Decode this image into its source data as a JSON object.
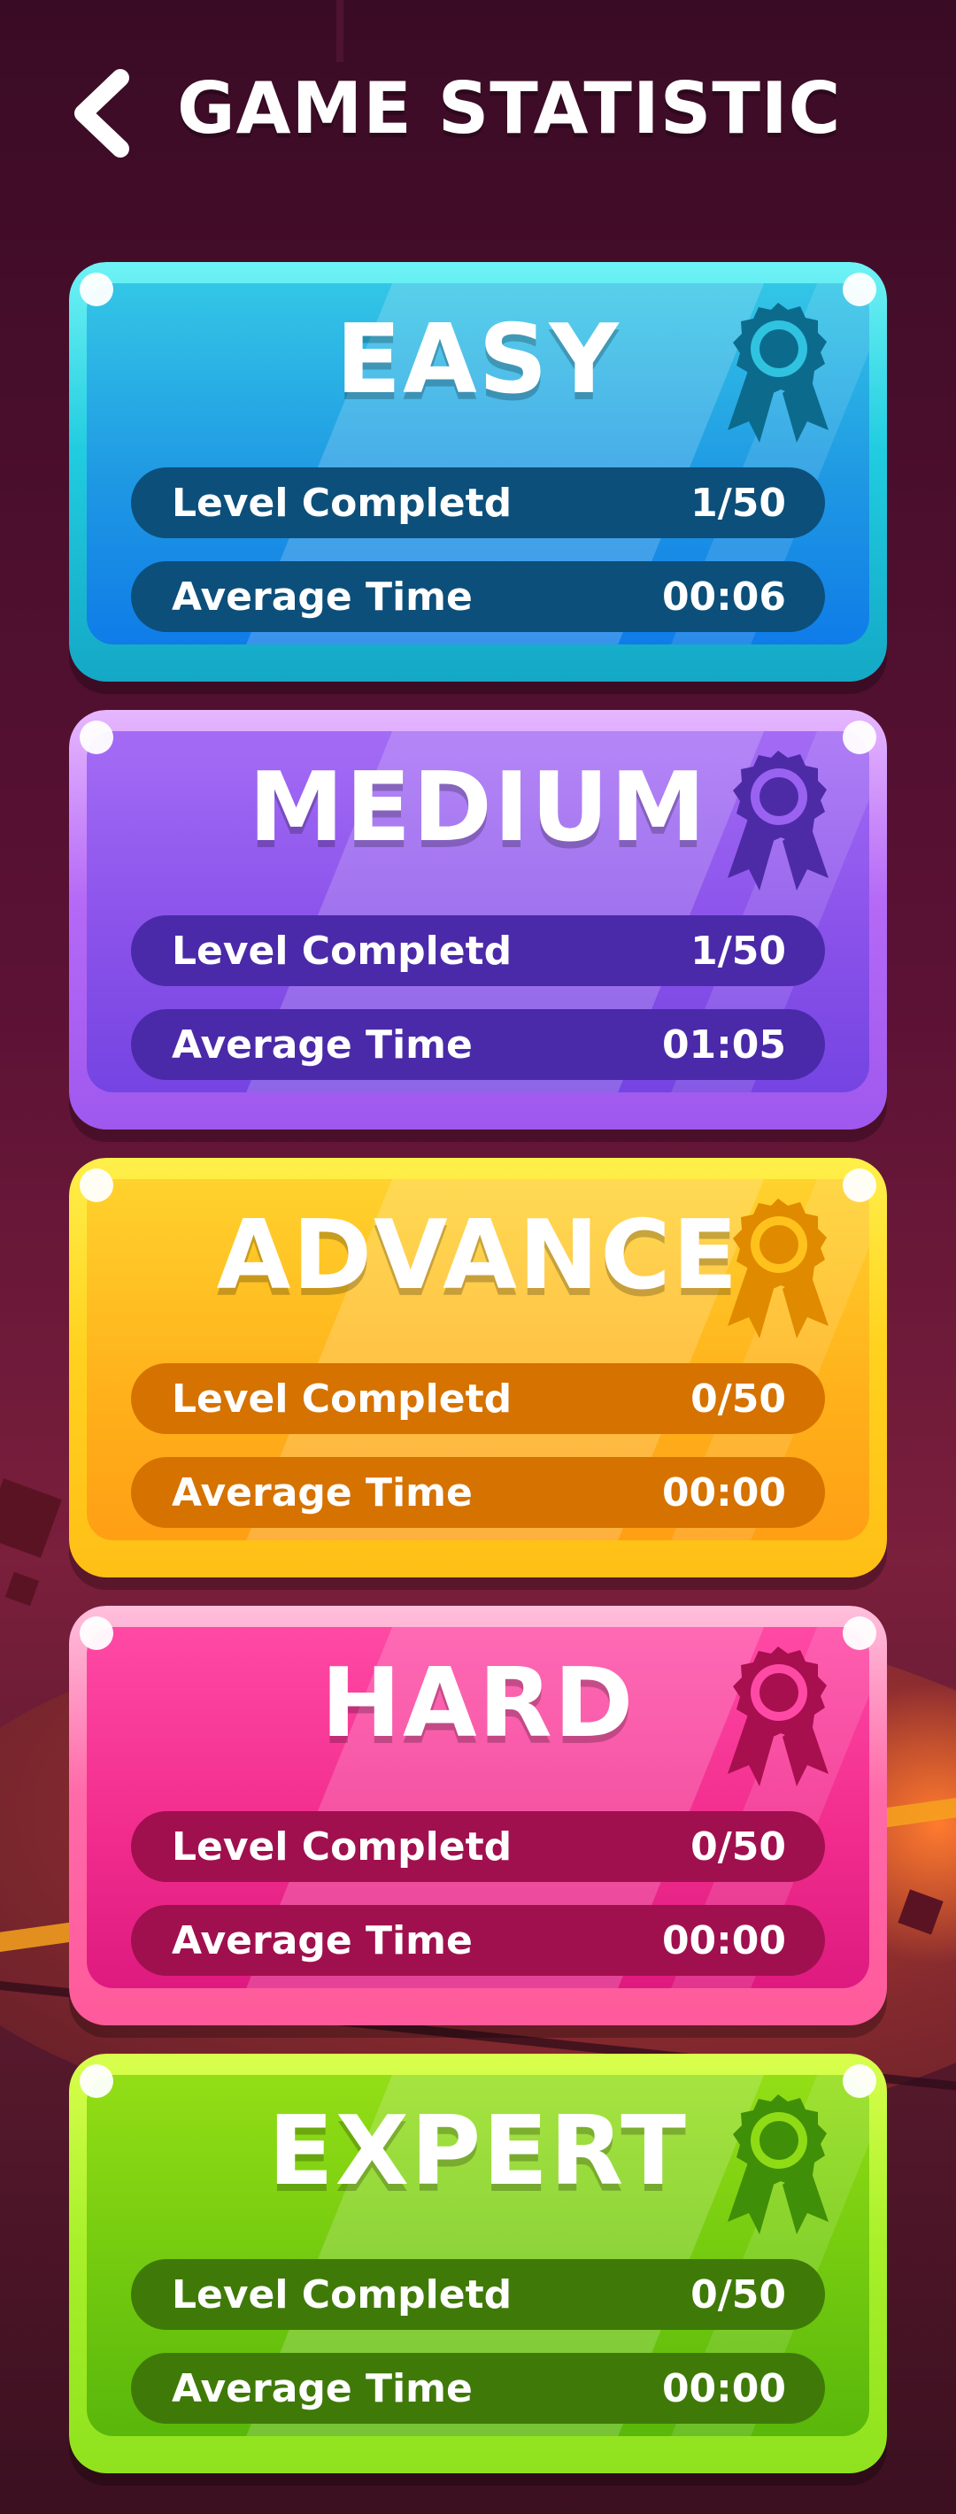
{
  "header": {
    "title": "GAME STATISTIC",
    "back_icon": "chevron-left-icon"
  },
  "stat_labels": {
    "level": "Level Completd",
    "time": "Average Time"
  },
  "cards": [
    {
      "id": "easy",
      "title": "EASY",
      "level_completed": "1/50",
      "average_time": "00:06",
      "medal_icon": "award-ribbon-icon",
      "medal_color": "#0c6b8c"
    },
    {
      "id": "medium",
      "title": "MEDIUM",
      "level_completed": "1/50",
      "average_time": "01:05",
      "medal_icon": "award-ribbon-icon",
      "medal_color": "#4d2ba6"
    },
    {
      "id": "advance",
      "title": "ADVANCE",
      "level_completed": "0/50",
      "average_time": "00:00",
      "medal_icon": "award-ribbon-icon",
      "medal_color": "#e08a00"
    },
    {
      "id": "hard",
      "title": "HARD",
      "level_completed": "0/50",
      "average_time": "00:00",
      "medal_icon": "award-ribbon-icon",
      "medal_color": "#a80f4f"
    },
    {
      "id": "expert",
      "title": "EXPERT",
      "level_completed": "0/50",
      "average_time": "00:00",
      "medal_icon": "award-ribbon-icon",
      "medal_color": "#3f8f08"
    }
  ]
}
